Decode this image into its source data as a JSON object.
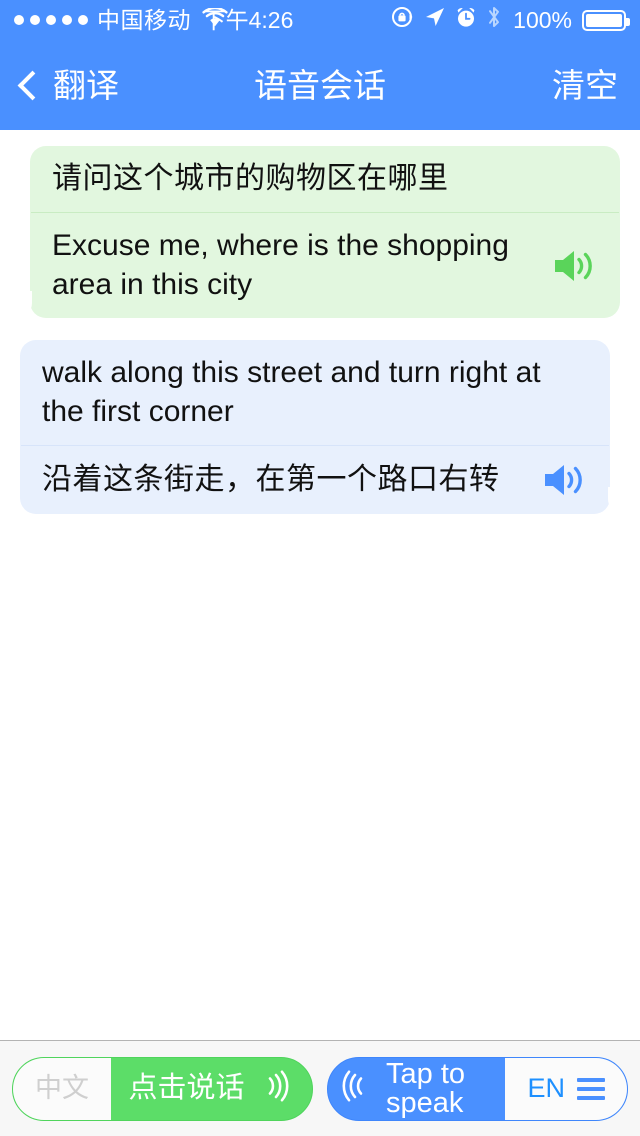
{
  "status_bar": {
    "signal_dots": 5,
    "carrier": "中国移动",
    "wifi_icon": "wifi-icon",
    "time": "下午4:26",
    "rotation_lock_icon": "rotation-lock-icon",
    "location_icon": "location-arrow-icon",
    "alarm_icon": "alarm-clock-icon",
    "bluetooth_icon": "bluetooth-icon",
    "battery_percent": "100%",
    "battery_icon": "battery-full-icon"
  },
  "nav_bar": {
    "back_label": "翻译",
    "back_icon": "chevron-left-icon",
    "title": "语音会话",
    "action_label": "清空",
    "background_color": "#4a90ff",
    "text_color": "#ffffff"
  },
  "conversation": {
    "messages": [
      {
        "side": "left",
        "style": "green",
        "bubble_color": "#e2f7df",
        "speaker_icon_color": "#5ad45a",
        "source_text": "请问这个城市的购物区在哪里",
        "source_lang": "cn",
        "translated_text": "Excuse me, where is the shopping area in this city",
        "translated_lang": "en",
        "speaker_icon": "speaker-icon"
      },
      {
        "side": "right",
        "style": "blue",
        "bubble_color": "#e8f0fd",
        "speaker_icon_color": "#4a90ff",
        "source_text": "walk along this street and turn right at the first corner",
        "source_lang": "en",
        "translated_text": "沿着这条街走，在第一个路口右转",
        "translated_lang": "cn",
        "speaker_icon": "speaker-icon"
      }
    ]
  },
  "toolbar": {
    "left_button": {
      "lang_label": "中文",
      "speak_label": "点击说话",
      "wave_icon": "sound-waves-icon",
      "color": "#5cdd68"
    },
    "right_button": {
      "wave_icon": "sound-waves-icon",
      "speak_label": "Tap to speak",
      "lang_label": "EN",
      "menu_icon": "hamburger-menu-icon",
      "color": "#4a90ff"
    }
  }
}
